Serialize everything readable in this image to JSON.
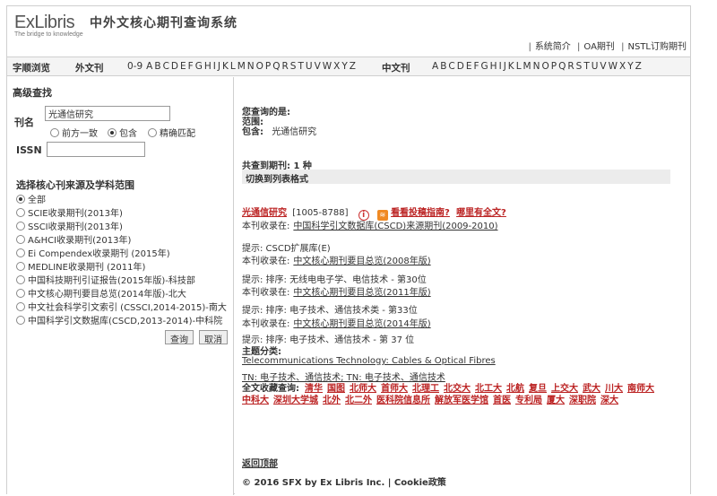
{
  "header": {
    "logo_text": "ExLibris",
    "logo_tagline": "The bridge to knowledge",
    "title": "中外文核心期刊查询系统",
    "links": [
      "系统简介",
      "OA期刊",
      "NSTL订购期刊"
    ]
  },
  "browse": {
    "label": "字顺浏览",
    "foreign_label": "外文刊",
    "foreign_letters": [
      "0-9",
      "A",
      "B",
      "C",
      "D",
      "E",
      "F",
      "G",
      "H",
      "I",
      "J",
      "K",
      "L",
      "M",
      "N",
      "O",
      "P",
      "Q",
      "R",
      "S",
      "T",
      "U",
      "V",
      "W",
      "X",
      "Y",
      "Z"
    ],
    "chinese_label": "中文刊",
    "chinese_letters": [
      "A",
      "B",
      "C",
      "D",
      "E",
      "F",
      "G",
      "H",
      "I",
      "J",
      "K",
      "L",
      "M",
      "N",
      "O",
      "P",
      "Q",
      "R",
      "S",
      "T",
      "U",
      "V",
      "W",
      "X",
      "Y",
      "Z"
    ]
  },
  "left": {
    "advanced_title": "高级查找",
    "title_label": "刊名",
    "title_value": "光通信研究",
    "match_options": [
      {
        "label": "前方一致",
        "selected": false
      },
      {
        "label": "包含",
        "selected": true
      },
      {
        "label": "精确匹配",
        "selected": false
      }
    ],
    "issn_label": "ISSN",
    "issn_value": "",
    "scope_title": "选择核心刊来源及学科范围",
    "scopes": [
      {
        "label": "全部",
        "selected": true
      },
      {
        "label": "SCIE收录期刊(2013年)",
        "selected": false
      },
      {
        "label": "SSCI收录期刊(2013年)",
        "selected": false
      },
      {
        "label": "A&HCI收录期刊(2013年)",
        "selected": false
      },
      {
        "label": "Ei Compendex收录期刊 (2015年)",
        "selected": false
      },
      {
        "label": "MEDLINE收录期刊 (2011年)",
        "selected": false
      },
      {
        "label": "中国科技期刊引证报告(2015年版)-科技部",
        "selected": false
      },
      {
        "label": "中文核心期刊要目总览(2014年版)-北大",
        "selected": false
      },
      {
        "label": "中文社会科学引文索引 (CSSCI,2014-2015)-南大",
        "selected": false
      },
      {
        "label": "中国科学引文数据库(CSCD,2013-2014)-中科院",
        "selected": false
      }
    ],
    "search_button": "查询",
    "cancel_button": "取消"
  },
  "result": {
    "query_heading": "您查询的是:",
    "scope_line": "范围:",
    "contains_label": "包含:",
    "contains_value": "光通信研究",
    "found_text": "共查到期刊: 1 种",
    "switch_format": "切换到列表格式",
    "journal_title": "光通信研究",
    "journal_issn": "[1005-8788]",
    "guide_link": "看看投稿指南?",
    "fulltext_link": "哪里有全文?",
    "entries": [
      {
        "prefix": "本刊收录在:",
        "link": "中国科学引文数据库(CSCD)来源期刊(2009-2010)"
      },
      {
        "prefix": "提示: CSCD扩展库(E)",
        "link": ""
      },
      {
        "prefix": "本刊收录在:",
        "link": "中文核心期刊要目总览(2008年版)"
      },
      {
        "prefix": "提示: 排序: 无线电电子学、电信技术 - 第30位",
        "link": ""
      },
      {
        "prefix": "本刊收录在:",
        "link": "中文核心期刊要目总览(2011年版)"
      },
      {
        "prefix": "提示: 排序: 电子技术、通信技术类 - 第33位",
        "link": ""
      },
      {
        "prefix": "本刊收录在:",
        "link": "中文核心期刊要目总览(2014年版)"
      },
      {
        "prefix": "提示: 排序: 电子技术、通信技术 - 第 37 位",
        "link": ""
      }
    ],
    "subject_label": "主题分类:",
    "subject_en": "Telecommunications Technology: Cables & Optical Fibres",
    "subject_cn": "TN: 电子技术、通信技术; TN: 电子技术、通信技术",
    "libraries_label": "全文收藏查询:",
    "libraries": [
      "清华",
      "国图",
      "北师大",
      "首师大",
      "北理工",
      "北交大",
      "北工大",
      "北航",
      "复旦",
      "上交大",
      "武大",
      "川大",
      "南师大",
      "中科大",
      "深圳大学城",
      "北外",
      "北二外",
      "医科院信息所",
      "解放军医学馆",
      "首医",
      "专利局",
      "厦大",
      "深职院",
      "深大"
    ],
    "back_link": "返回顶部",
    "footer": "© 2016 SFX by Ex Libris Inc. | Cookie政策"
  }
}
